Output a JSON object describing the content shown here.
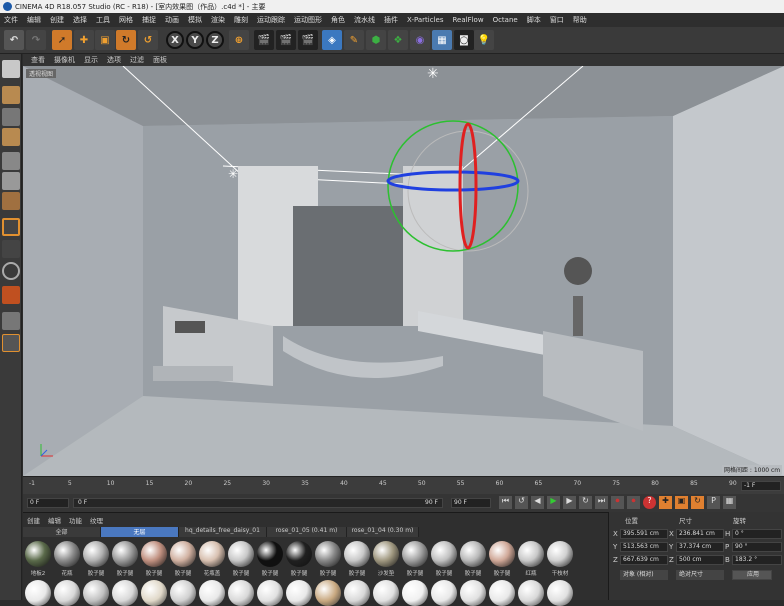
{
  "window_title": "CINEMA 4D R18.057 Studio (RC - R18) - [室内效果图（作品）.c4d *] - 主要",
  "menu": [
    "文件",
    "编辑",
    "创建",
    "选择",
    "工具",
    "网格",
    "捕捉",
    "动画",
    "模拟",
    "渲染",
    "雕刻",
    "运动跟踪",
    "运动图形",
    "角色",
    "流水线",
    "插件",
    "X-Particles",
    "RealFlow",
    "Octane",
    "脚本",
    "窗口",
    "帮助"
  ],
  "toolbar": {
    "axis_x": "X",
    "axis_y": "Y",
    "axis_z": "Z"
  },
  "viewport": {
    "menu": [
      "查看",
      "摄像机",
      "显示",
      "选项",
      "过滤",
      "面板"
    ],
    "label": "透视视图",
    "grid_spacing": "网格间距 : 1000 cm"
  },
  "timeline": {
    "ticks": [
      "-1",
      "5",
      "10",
      "15",
      "20",
      "25",
      "30",
      "35",
      "40",
      "45",
      "50",
      "55",
      "60",
      "65",
      "70",
      "75",
      "80",
      "85",
      "90"
    ],
    "end_field": "-1 F",
    "frame_start": "0 F",
    "frame_range_start": "0 F",
    "frame_range_end": "90 F",
    "frame_end": "90 F"
  },
  "material_panel": {
    "menu": [
      "创建",
      "编辑",
      "功能",
      "纹理"
    ],
    "tabs": [
      "全部",
      "无层",
      "hq_details_free_daisy_01",
      "rose_01_05 (0.41 m)",
      "rose_01_04 (0.30 m)"
    ],
    "row1_labels": [
      "地板2",
      "花瓶",
      "胶子腿",
      "胶子腿",
      "胶子腿",
      "胶子腿",
      "花瓶盖",
      "胶子腿",
      "胶子腿",
      "胶子腿",
      "胶子腿",
      "胶子腿",
      "沙发垫",
      "胶子腿",
      "胶子腿",
      "胶子腿",
      "胶子腿",
      "红瓶",
      "干枝材"
    ],
    "row1_colors": [
      "#5a6a4a",
      "#8a8a8a",
      "#b0b0b0",
      "#9a9a9a",
      "#c09080",
      "#d0b0a0",
      "#d8c0b0",
      "#c8c8c8",
      "#101010",
      "#202020",
      "#888888",
      "#c8c8c8",
      "#a09880",
      "#a0a0a0",
      "#c0c0c0",
      "#b8b8b8",
      "#d0a898",
      "#c8c8c8",
      "#d0d0d0"
    ],
    "row2_colors": [
      "#e8e8e8",
      "#d8d8d8",
      "#c0c0c0",
      "#d8d8d8",
      "#e0d8c8",
      "#d0d0d0",
      "#e8e8e8",
      "#d8d8d8",
      "#e0e0e0",
      "#e8e8e8",
      "#c8a880",
      "#d8d8d8",
      "#e0e0e0",
      "#f0f0f0",
      "#e8e8e8",
      "#e0e0e0",
      "#e8e8e8",
      "#d8d8d8",
      "#e0e0e0"
    ]
  },
  "coords": {
    "headers": [
      "位置",
      "尺寸",
      "旋转"
    ],
    "x_pos": "395.591 cm",
    "y_pos": "513.563 cm",
    "z_pos": "667.639 cm",
    "x_size": "236.841 cm",
    "y_size": "37.374 cm",
    "z_size": "500 cm",
    "h_rot": "0 °",
    "p_rot": "90 °",
    "b_rot": "183.2 °",
    "label_x": "X",
    "label_y": "Y",
    "label_z": "Z",
    "label_h": "H",
    "label_p": "P",
    "label_b": "B",
    "mode_object": "对象 (相对)",
    "mode_size": "绝对尺寸",
    "apply": "应用"
  }
}
